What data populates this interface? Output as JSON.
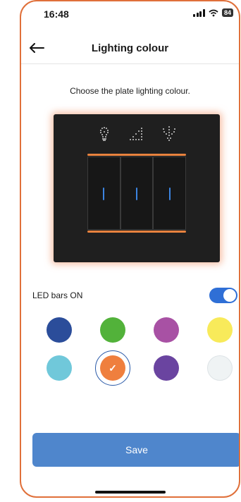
{
  "status_bar": {
    "time": "16:48",
    "battery": "84"
  },
  "header": {
    "title": "Lighting colour"
  },
  "subtitle": "Choose the plate lighting colour.",
  "led_toggle": {
    "label": "LED bars ON",
    "on": true
  },
  "colors": {
    "frame_accent": "#e0703a",
    "led_indicator": "#3c84e0",
    "plate_glow": "#f08c5f",
    "toggle_on": "#2f6fd6",
    "save_button": "#4f86cc"
  },
  "swatches": [
    {
      "name": "dark-blue",
      "color": "#2b4d9a",
      "selected": false
    },
    {
      "name": "green",
      "color": "#52b23a",
      "selected": false
    },
    {
      "name": "magenta",
      "color": "#a851a4",
      "selected": false
    },
    {
      "name": "yellow",
      "color": "#f8ea5a",
      "selected": false
    },
    {
      "name": "light-blue",
      "color": "#70c8da",
      "selected": false
    },
    {
      "name": "orange",
      "color": "#ef7f3e",
      "selected": true
    },
    {
      "name": "purple",
      "color": "#6a44a0",
      "selected": false
    },
    {
      "name": "white",
      "color": "#eff3f4",
      "selected": false
    }
  ],
  "save_label": "Save"
}
